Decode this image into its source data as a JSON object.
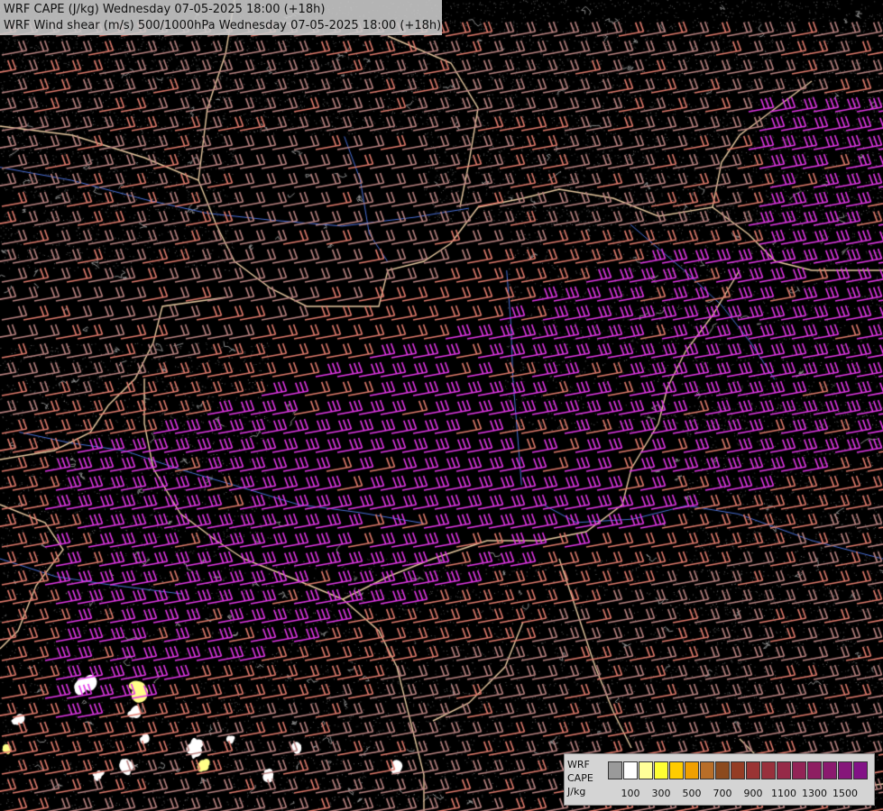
{
  "header": {
    "line1": "WRF CAPE (J/kg) Wednesday 07-05-2025 18:00 (+18h)",
    "line2": "WRF Wind shear (m/s) 500/1000hPa Wednesday 07-05-2025 18:00 (+18h)"
  },
  "legend": {
    "model_label": "WRF",
    "field_label": "CAPE",
    "unit_label": "J/kg",
    "colors": [
      "#9a9a9a",
      "#ffffff",
      "#ffff99",
      "#ffff33",
      "#ffcc00",
      "#f0a000",
      "#b86e28",
      "#8c4a1e",
      "#943c24",
      "#9a3434",
      "#98303c",
      "#962a48",
      "#922456",
      "#8e1e62",
      "#8a1a6e",
      "#86167a",
      "#821286"
    ],
    "ticks": [
      {
        "label": "100",
        "index": 1
      },
      {
        "label": "300",
        "index": 3
      },
      {
        "label": "500",
        "index": 5
      },
      {
        "label": "700",
        "index": 7
      },
      {
        "label": "900",
        "index": 9
      },
      {
        "label": "1100",
        "index": 11
      },
      {
        "label": "1300",
        "index": 13
      },
      {
        "label": "1500",
        "index": 15
      }
    ]
  },
  "barb_colors": {
    "weak": "#b98280",
    "moderate": "#e07a6c",
    "strong": "#e236e6"
  },
  "map_colors": {
    "background": "#000000",
    "border": "#e8c9a0",
    "river": "#4a6fd6",
    "terrain": "#a0a0a0",
    "cape_low": "#ffffff",
    "cape_mid": "#ffff88"
  }
}
